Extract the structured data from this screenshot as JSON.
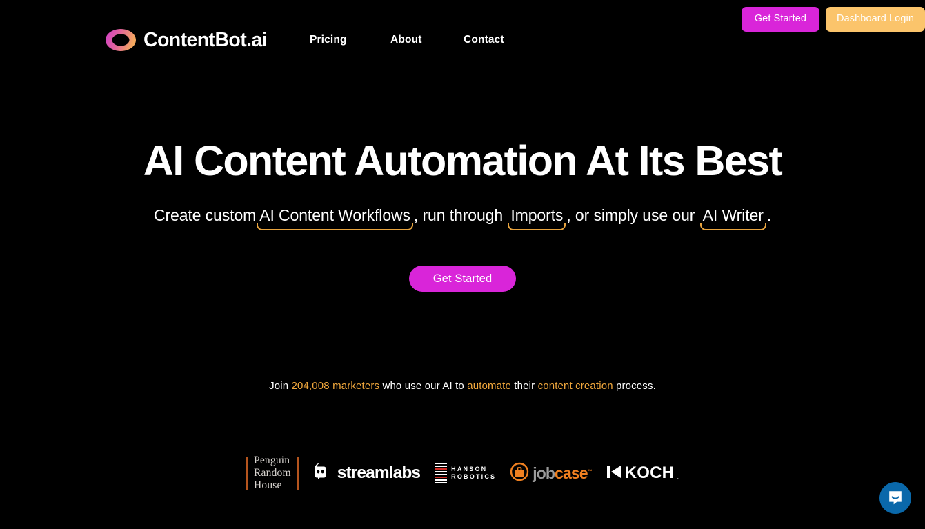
{
  "brand": {
    "name": "ContentBot.ai",
    "logo_gradient_start": "#d13fc9",
    "logo_gradient_end": "#f5a85f"
  },
  "topbar": {
    "get_started_label": "Get Started",
    "dashboard_login_label": "Dashboard Login",
    "get_started_color": "#d925d9",
    "dashboard_login_color": "#fbc46b"
  },
  "nav": {
    "items": [
      {
        "label": "Pricing"
      },
      {
        "label": "About"
      },
      {
        "label": "Contact"
      }
    ]
  },
  "hero": {
    "title": "AI Content Automation At Its Best",
    "sub": {
      "part1": "Create custom",
      "highlight1": "AI Content Workflows",
      "part2": ", run through ",
      "highlight2": "Imports",
      "part3": ", or simply use our ",
      "highlight3": "AI Writer",
      "part4": ".",
      "highlight_color": "#e8a43f"
    },
    "cta_label": "Get Started",
    "cta_color": "#d925d9"
  },
  "social_proof": {
    "prefix": "Join ",
    "count": "204,008 marketers",
    "middle": " who use our AI to ",
    "accent2": "automate",
    "middle2": " their ",
    "accent3": "content creation",
    "suffix": " process.",
    "accent_color": "#f0a73c"
  },
  "client_logos": {
    "penguin": {
      "line1": "Penguin",
      "line2": "Random",
      "line3": "House"
    },
    "streamlabs": {
      "name": "streamlabs"
    },
    "hanson": {
      "line1": "HANSON",
      "line2": "ROBOTICS"
    },
    "jobcase": {
      "part1": "job",
      "part2": "case",
      "tm": "™"
    },
    "koch": {
      "name": "KOCH",
      "dot": "."
    }
  },
  "chat": {
    "launcher_label": "Open Intercom Messenger",
    "launcher_color": "#0a68aa"
  }
}
